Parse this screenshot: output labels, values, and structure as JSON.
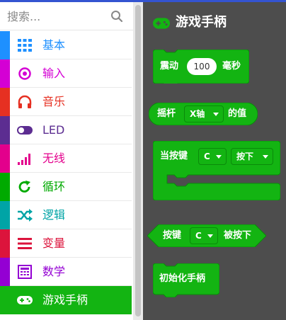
{
  "search": {
    "placeholder": "搜索..."
  },
  "categories": [
    {
      "label": "基本",
      "color": "#1e90ff",
      "icon": "grid-icon"
    },
    {
      "label": "输入",
      "color": "#d400d4",
      "icon": "target-icon"
    },
    {
      "label": "音乐",
      "color": "#e63022",
      "icon": "headphones-icon"
    },
    {
      "label": "LED",
      "color": "#5c2d91",
      "icon": "toggle-icon"
    },
    {
      "label": "无线",
      "color": "#e3008c",
      "icon": "signal-bars-icon"
    },
    {
      "label": "循环",
      "color": "#00aa00",
      "icon": "refresh-icon"
    },
    {
      "label": "逻辑",
      "color": "#00a4a6",
      "icon": "shuffle-icon"
    },
    {
      "label": "变量",
      "color": "#dc143c",
      "icon": "list-lines-icon"
    },
    {
      "label": "数学",
      "color": "#9400d3",
      "icon": "calculator-icon"
    },
    {
      "label": "游戏手柄",
      "color": "#13b412",
      "icon": "gamepad-icon"
    }
  ],
  "flyout": {
    "title": "游戏手柄",
    "title_icon": "gamepad-icon",
    "block_color": "#13b412",
    "blocks": {
      "shake": {
        "prefix": "震动",
        "value": "100",
        "suffix": "毫秒"
      },
      "joystick": {
        "prefix": "摇杆",
        "dropdown": "X轴",
        "suffix": "的值"
      },
      "on_button": {
        "prefix": "当按键",
        "button": "C",
        "action": "按下"
      },
      "button_pressed": {
        "prefix": "按键",
        "button": "C",
        "suffix": "被按下"
      },
      "init": {
        "label": "初始化手柄"
      }
    }
  }
}
